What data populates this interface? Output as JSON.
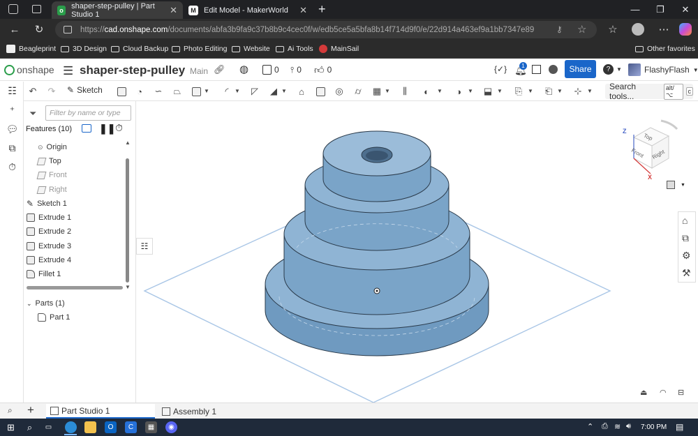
{
  "browser": {
    "tabs": [
      {
        "title": "shaper-step-pulley | Part Studio 1",
        "active": true
      },
      {
        "title": "Edit Model - MakerWorld",
        "active": false
      }
    ],
    "url_prefix": "https://",
    "url_domain": "cad.onshape.com",
    "url_path": "/documents/abfa3b9fa9c37b8b9c4cec0f/w/edb5ce5a5bfa8b14f714d9f0/e/22d914a463ef9a1bb7347e89",
    "bookmarks": [
      "Beagleprint",
      "3D Design",
      "Cloud Backup",
      "Photo Editing",
      "Website",
      "Ai Tools",
      "MainSail"
    ],
    "other_favorites": "Other favorites"
  },
  "onshape": {
    "logo_text": "onshape",
    "doc_name": "shaper-step-pulley",
    "branch": "Main",
    "versions_count": "0",
    "branches_count": "0",
    "likes_count": "0",
    "notification_count": "1",
    "share_label": "Share",
    "user_name": "FlashyFlash"
  },
  "toolbar": {
    "sketch_label": "Sketch",
    "search_label": "Search tools...",
    "shortcut_1": "alt/⌥",
    "shortcut_2": "c"
  },
  "features": {
    "filter_placeholder": "Filter by name or type",
    "header": "Features (10)",
    "items": [
      {
        "label": "Origin",
        "kind": "origin"
      },
      {
        "label": "Top",
        "kind": "plane"
      },
      {
        "label": "Front",
        "kind": "plane-hidden"
      },
      {
        "label": "Right",
        "kind": "plane-hidden"
      },
      {
        "label": "Sketch 1",
        "kind": "sketch"
      },
      {
        "label": "Extrude 1",
        "kind": "extrude"
      },
      {
        "label": "Extrude 2",
        "kind": "extrude"
      },
      {
        "label": "Extrude 3",
        "kind": "extrude"
      },
      {
        "label": "Extrude 4",
        "kind": "extrude"
      },
      {
        "label": "Fillet 1",
        "kind": "fillet"
      }
    ],
    "parts_header": "Parts (1)",
    "parts": [
      "Part 1"
    ]
  },
  "viewcube": {
    "top": "Top",
    "front": "Front",
    "right": "Right",
    "z": "Z",
    "x": "X"
  },
  "bottom_tabs": [
    "Part Studio 1",
    "Assembly 1"
  ],
  "taskbar": {
    "time": "7:00 PM"
  },
  "colors": {
    "accent": "#1a66c9",
    "part_fill": "#8fb4d4",
    "part_edge": "#2a3a4a",
    "plane": "#a9c6e6"
  }
}
